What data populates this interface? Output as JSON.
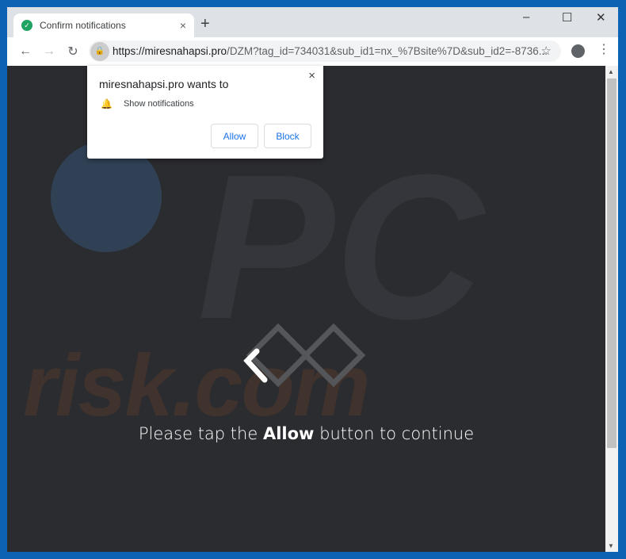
{
  "tab": {
    "title": "Confirm notifications",
    "favicon": "check-circle-icon",
    "close": "×"
  },
  "new_tab": "+",
  "window_controls": {
    "minimize": "–",
    "maximize": "☐",
    "close": "✕"
  },
  "nav": {
    "back": "←",
    "forward": "→",
    "reload": "↻"
  },
  "address": {
    "host": "https://miresnahapsi.pro",
    "path": "/DZM?tag_id=734031&sub_id1=nx_%7Bsite%7D&sub_id2=-8736..."
  },
  "popup": {
    "title": "miresnahapsi.pro wants to",
    "permission": "Show notifications",
    "allow": "Allow",
    "block": "Block",
    "close": "×"
  },
  "page": {
    "msg_before": "Please tap the ",
    "msg_bold": "Allow",
    "msg_after": " button to continue"
  },
  "watermark": {
    "text": "risk.com",
    "pc": "PC"
  },
  "colors": {
    "frame": "#0d63b3",
    "content_bg": "#2b2c30",
    "link_blue": "#1a73e8"
  }
}
